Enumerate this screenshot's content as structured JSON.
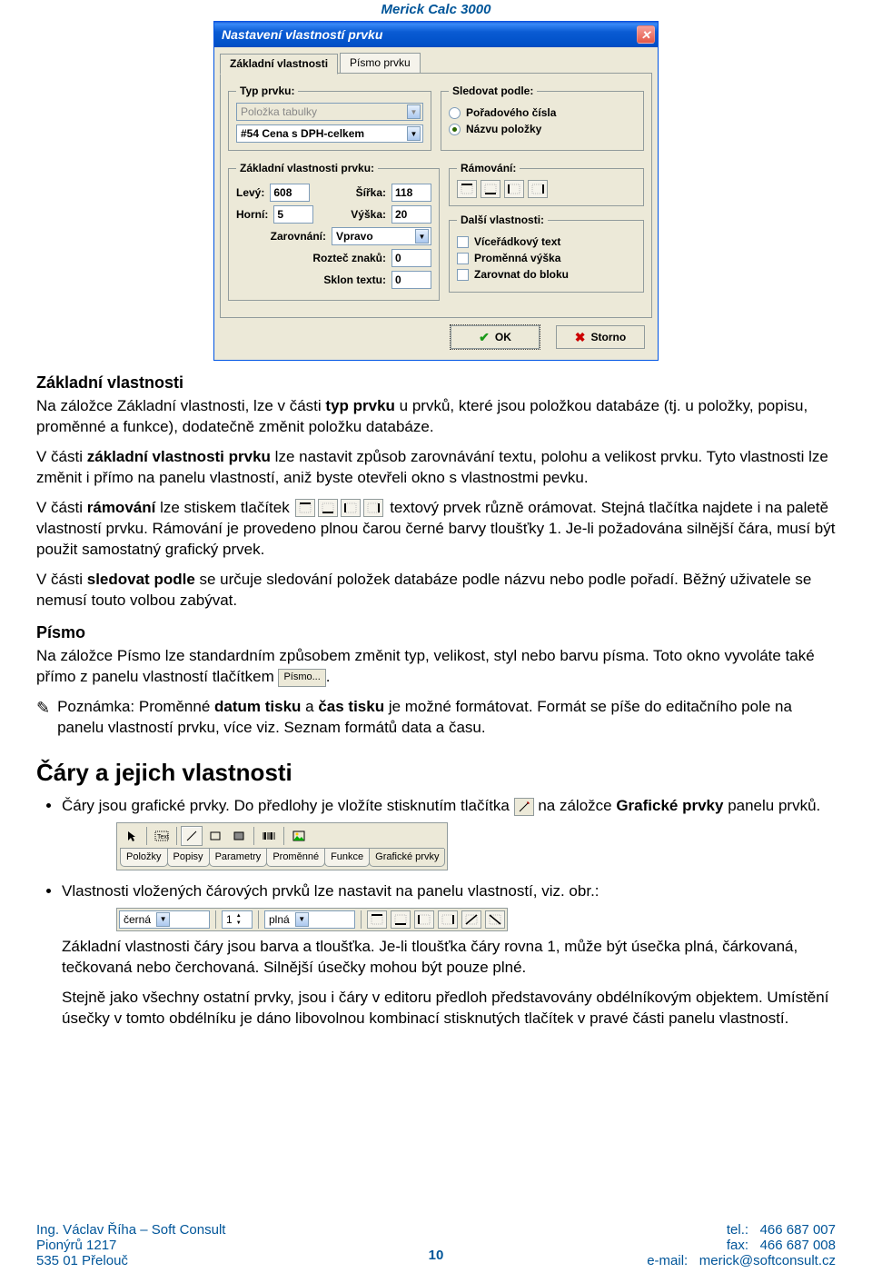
{
  "header": {
    "title": "Merick Calc 3000"
  },
  "dialog": {
    "title": "Nastavení vlastností prvku",
    "tabs": {
      "t1": "Základní vlastnosti",
      "t2": "Písmo prvku"
    },
    "typ_prvku": {
      "legend": "Typ prvku:",
      "combo_disabled": "Položka tabulky",
      "combo_value": "#54 Cena s DPH-celkem"
    },
    "sledovat": {
      "legend": "Sledovat podle:",
      "opt1": "Pořadového čísla",
      "opt2": "Názvu položky"
    },
    "zakladni": {
      "legend": "Základní vlastnosti prvku:",
      "levy_lbl": "Levý:",
      "levy_val": "608",
      "sirka_lbl": "Šířka:",
      "sirka_val": "118",
      "horni_lbl": "Horní:",
      "horni_val": "5",
      "vyska_lbl": "Výška:",
      "vyska_val": "20",
      "zarovnani_lbl": "Zarovnání:",
      "zarovnani_val": "Vpravo",
      "roztec_lbl": "Rozteč znaků:",
      "roztec_val": "0",
      "sklon_lbl": "Sklon textu:",
      "sklon_val": "0"
    },
    "ramovani": {
      "legend": "Rámování:"
    },
    "dalsi": {
      "legend": "Další vlastnosti:",
      "c1": "Víceřádkový text",
      "c2": "Proměnná výška",
      "c3": "Zarovnat do bloku"
    },
    "buttons": {
      "ok": "OK",
      "storno": "Storno"
    }
  },
  "doc": {
    "h3_basic": "Základní vlastnosti",
    "p_basic_1a": "Na záložce Základní vlastnosti, lze v části ",
    "p_basic_1b_strong": "typ prvku",
    "p_basic_1c": " u prvků, které jsou položkou databáze (tj. u položky, popisu, proměnné a funkce), dodatečně změnit položku databáze.",
    "p_basic_2a": "V části ",
    "p_basic_2b_strong": "základní vlastnosti prvku",
    "p_basic_2c": " lze nastavit způsob zarovnávání textu, polohu a velikost prvku. Tyto vlastnosti lze změnit i přímo na panelu vlastností, aniž byste otevřeli okno s vlastnostmi pevku.",
    "p_ram_1a": "V části ",
    "p_ram_1b_strong": "rámování",
    "p_ram_1c": " lze stiskem tlačítek ",
    "p_ram_1d": " textový prvek různě orámovat. Stejná tlačítka najdete i na paletě vlastností prvku. Rámování je provedeno plnou čarou černé barvy tloušťky 1. Je-li požadována silnější čára, musí být použit samostatný grafický prvek.",
    "p_sled_1a": "V části ",
    "p_sled_1b_strong": "sledovat podle",
    "p_sled_1c": " se určuje sledování položek databáze podle názvu nebo podle pořadí. Běžný uživatele se nemusí touto volbou zabývat.",
    "h3_pismo": "Písmo",
    "p_pismo_a": "Na záložce Písmo lze standardním způsobem změnit typ, velikost, styl nebo barvu písma. Toto okno vyvoláte také přímo z panelu vlastností tlačítkem ",
    "pismo_btn": "Písmo...",
    "p_pismo_b": ".",
    "note_a": "Poznámka: Proměnné ",
    "note_b1": "datum tisku",
    "note_b2": " a ",
    "note_b3": "čas tisku",
    "note_c": " je možné formátovat. Formát se píše do editačního pole na panelu vlastností prvku, více viz. Seznam formátů data a času.",
    "h2_cary": "Čáry a jejich vlastnosti",
    "li1_a": "Čáry jsou grafické prvky. Do předlohy je vložíte stisknutím tlačítka ",
    "li1_b": " na záložce ",
    "li1_c_strong": "Grafické prvky",
    "li1_d": " panelu prvků.",
    "toolbar_tabs": {
      "t1": "Položky",
      "t2": "Popisy",
      "t3": "Parametry",
      "t4": "Proměnné",
      "t5": "Funkce",
      "t6": "Grafické prvky"
    },
    "li2": "Vlastnosti vložených čárových prvků lze nastavit na panelu vlastností, viz. obr.:",
    "prop_color": "černá",
    "prop_width": "1",
    "prop_style": "plná",
    "p_line_1": "Základní vlastnosti čáry jsou barva a tloušťka. Je-li tloušťka čáry rovna 1, může být úsečka plná, čárkovaná, tečkovaná nebo čerchovaná. Silnější úsečky mohou být pouze plné.",
    "p_line_2": "Stejně jako všechny ostatní prvky, jsou i čáry v editoru předloh představovány obdélníkovým objektem. Umístění úsečky v tomto obdélníku je dáno libovolnou kombinací stisknutých tlačítek v pravé části panelu vlastností."
  },
  "footer": {
    "l1": "Ing. Václav Říha – Soft Consult",
    "r1l": "tel.:",
    "r1v": "466 687 007",
    "l2": "Pionýrů 1217",
    "r2l": "fax:",
    "r2v": "466 687 008",
    "l3": "535 01  Přelouč",
    "r3l": "e-mail:",
    "r3v": "merick@softconsult.cz",
    "page": "10"
  }
}
